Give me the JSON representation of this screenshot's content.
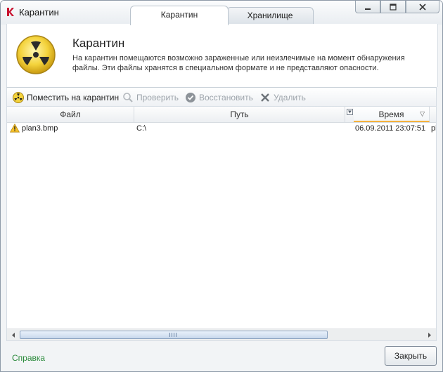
{
  "window": {
    "title": "Карантин"
  },
  "tabs": [
    {
      "label": "Карантин",
      "active": true
    },
    {
      "label": "Хранилище",
      "active": false
    }
  ],
  "window_controls": {
    "minimize": "—",
    "maximize": "☐",
    "close": "✕"
  },
  "header": {
    "icon": "radiation-icon",
    "title": "Карантин",
    "description": "На карантин помещаются возможно зараженные или неизлечимые на момент обнаружения файлы. Эти файлы хранятся в специальном формате и не представляют опасности."
  },
  "toolbar": {
    "quarantine_label": "Поместить на карантин",
    "check_label": "Проверить",
    "restore_label": "Восстановить",
    "delete_label": "Удалить"
  },
  "table": {
    "columns": [
      "Файл",
      "Путь",
      "Время"
    ],
    "sorted_column": "Время",
    "rows": [
      {
        "file": "plan3.bmp",
        "path": "C:\\",
        "time": "06.09.2011 23:07:51",
        "extra": "pl",
        "icon": "warning-icon"
      }
    ]
  },
  "colors": {
    "accent": "#f5b23e",
    "link": "#2a8a3b"
  },
  "footer": {
    "help_label": "Справка",
    "close_label": "Закрыть"
  }
}
